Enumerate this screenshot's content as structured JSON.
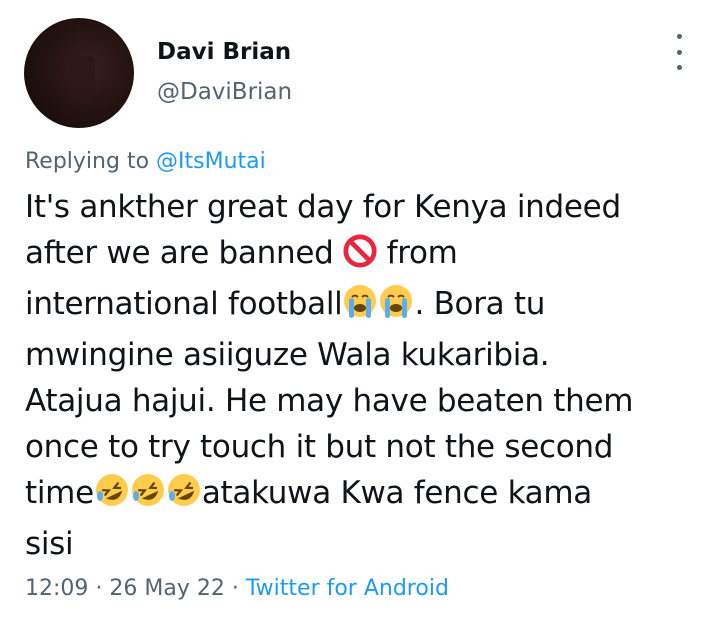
{
  "author": {
    "display_name": "Davi Brian",
    "handle": "@DaviBrian"
  },
  "more_menu_icon": "three-dots-vertical-icon",
  "reply": {
    "prefix": "Replying to",
    "mention": "@ItsMutai"
  },
  "tweet": {
    "lines": [
      "It's ankther great day for Kenya indeed",
      "after we are banned",
      "from",
      "international football",
      ". Bora tu",
      "mwingine asiiguze Wala kukaribia.",
      "Atajua hajui. He may have beaten them",
      "once to try touch it but not the second",
      "time",
      "atakuwa Kwa fence kama",
      "sisi"
    ],
    "emojis": [
      "no-entry-sign-emoji",
      "loudly-crying-face-emoji",
      "rolling-on-floor-laughing-emoji"
    ]
  },
  "meta": {
    "time": "12:09",
    "separator": "·",
    "date": "26 May 22",
    "source": "Twitter for Android"
  },
  "colors": {
    "text": "#0f1419",
    "secondary": "#536471",
    "link": "#1d9bf0"
  }
}
